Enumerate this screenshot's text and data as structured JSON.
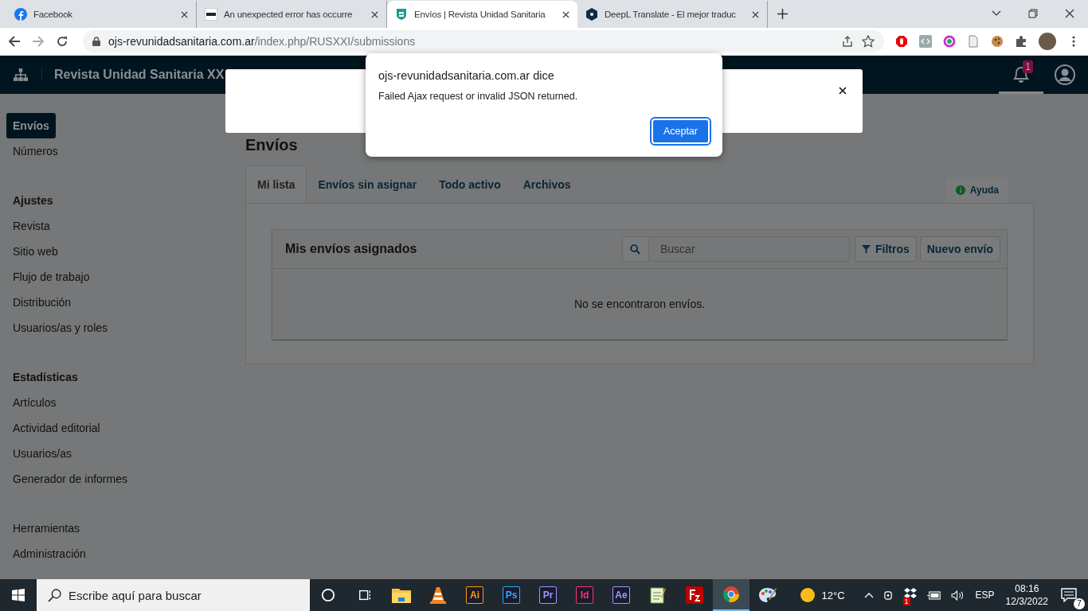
{
  "browser": {
    "tabs": [
      {
        "title": "Facebook",
        "selected": false
      },
      {
        "title": "An unexpected error has occurre",
        "selected": false
      },
      {
        "title": "Envíos | Revista Unidad Sanitaria",
        "selected": true
      },
      {
        "title": "DeepL Translate - El mejor traduc",
        "selected": false
      }
    ],
    "address": {
      "domain": "ojs-revunidadsanitaria.com.ar",
      "path": "/index.php/RUSXXI/submissions"
    }
  },
  "header": {
    "title": "Revista Unidad Sanitaria XX",
    "notification_count": "1"
  },
  "sidebar": {
    "sections": [
      {
        "items": [
          {
            "label": "Envíos",
            "selected": true
          },
          {
            "label": "Números",
            "selected": false
          }
        ]
      },
      {
        "heading": "Ajustes",
        "items": [
          {
            "label": "Revista",
            "selected": false
          },
          {
            "label": "Sitio web",
            "selected": false
          },
          {
            "label": "Flujo de trabajo",
            "selected": false
          },
          {
            "label": "Distribución",
            "selected": false
          },
          {
            "label": "Usuarios/as y roles",
            "selected": false
          }
        ]
      },
      {
        "heading": "Estadísticas",
        "items": [
          {
            "label": "Artículos",
            "selected": false
          },
          {
            "label": "Actividad editorial",
            "selected": false
          },
          {
            "label": "Usuarios/as",
            "selected": false
          },
          {
            "label": "Generador de informes",
            "selected": false
          }
        ]
      },
      {
        "items": [
          {
            "label": "Herramientas",
            "selected": false
          },
          {
            "label": "Administración",
            "selected": false
          }
        ]
      }
    ]
  },
  "page": {
    "title": "Envíos",
    "tabs": [
      {
        "label": "Mi lista",
        "selected": true
      },
      {
        "label": "Envíos sin asignar",
        "selected": false
      },
      {
        "label": "Todo activo",
        "selected": false
      },
      {
        "label": "Archivos",
        "selected": false
      }
    ],
    "help_button": "Ayuda",
    "list": {
      "title": "Mis envíos asignados",
      "search_placeholder": "Buscar",
      "filter_button": "Filtros",
      "new_button": "Nuevo envío",
      "empty_message": "No se encontraron envíos."
    }
  },
  "alert": {
    "title": "ojs-revunidadsanitaria.com.ar dice",
    "message": "Failed Ajax request or invalid JSON returned.",
    "button": "Aceptar"
  },
  "taskbar": {
    "search_placeholder": "Escribe aquí para buscar",
    "apps": [
      {
        "kind": "cortana"
      },
      {
        "kind": "taskview"
      },
      {
        "kind": "folder"
      },
      {
        "kind": "cone"
      },
      {
        "kind": "adobe",
        "label": "Ai",
        "color": "#ff9a00"
      },
      {
        "kind": "adobe",
        "label": "Ps",
        "color": "#31a8ff"
      },
      {
        "kind": "adobe",
        "label": "Pr",
        "color": "#9999ff"
      },
      {
        "kind": "adobe",
        "label": "Id",
        "color": "#ff3366"
      },
      {
        "kind": "adobe",
        "label": "Ae",
        "color": "#9999ff"
      },
      {
        "kind": "notepad"
      },
      {
        "kind": "filezilla"
      },
      {
        "kind": "chrome"
      },
      {
        "kind": "paint"
      }
    ],
    "weather": "12°C",
    "tray_badge": "1",
    "language": "ESP",
    "time": "08:16",
    "date": "12/3/2022",
    "notifications": "7"
  }
}
